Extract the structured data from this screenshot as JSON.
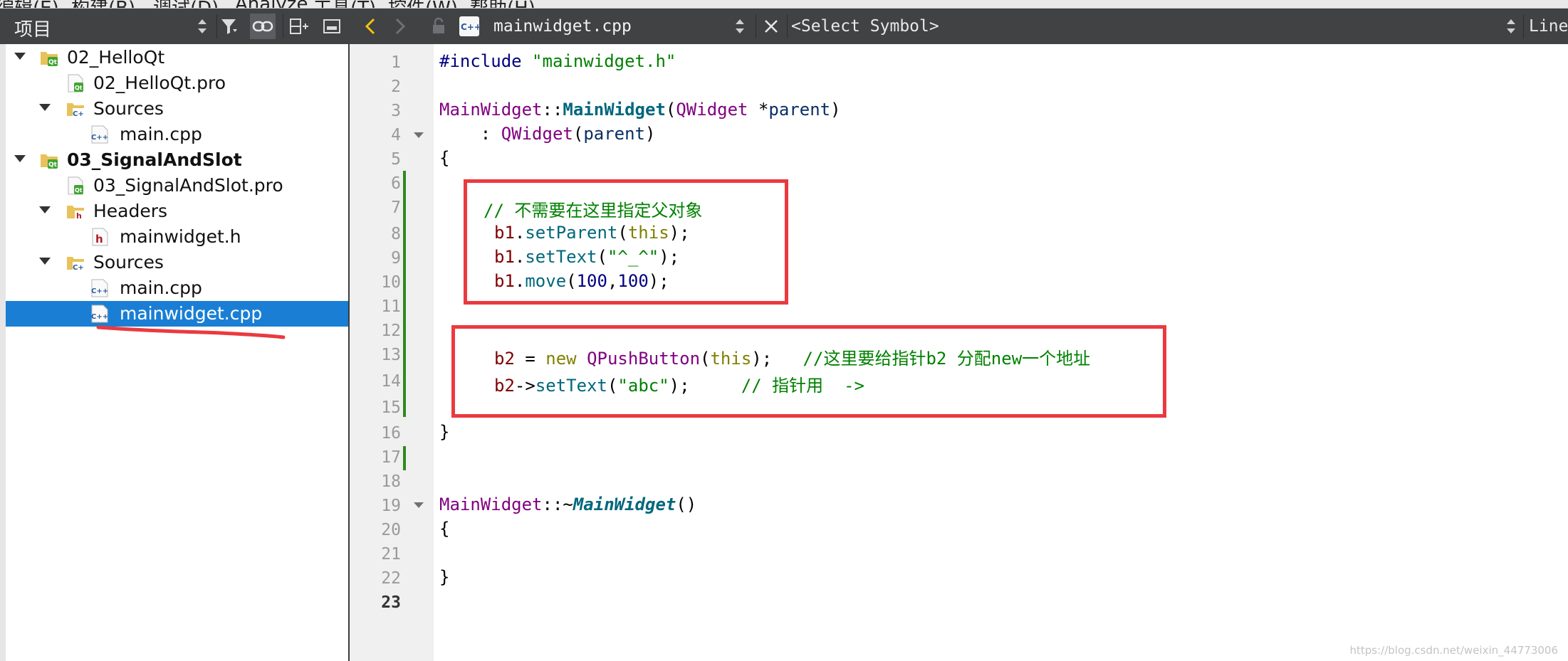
{
  "menubar": {
    "items": [
      "编辑(E)",
      "构建(B)",
      "调试(D)",
      "Analyze",
      "工具(T)",
      "控件(W)",
      "帮助(H)"
    ]
  },
  "project_panel": {
    "title": "项目",
    "tree": [
      {
        "label": "02_HelloQt",
        "icon": "qt-project-folder-icon",
        "bold": false
      },
      {
        "label": "02_HelloQt.pro",
        "icon": "pro-file-icon",
        "bold": false
      },
      {
        "label": "Sources",
        "icon": "cpp-sources-folder-icon",
        "bold": false
      },
      {
        "label": "main.cpp",
        "icon": "cpp-file-icon",
        "bold": false
      },
      {
        "label": "03_SignalAndSlot",
        "icon": "qt-project-folder-icon",
        "bold": true
      },
      {
        "label": "03_SignalAndSlot.pro",
        "icon": "pro-file-icon",
        "bold": false
      },
      {
        "label": "Headers",
        "icon": "header-folder-icon",
        "bold": false
      },
      {
        "label": "mainwidget.h",
        "icon": "header-file-icon",
        "bold": false
      },
      {
        "label": "Sources",
        "icon": "cpp-sources-folder-icon",
        "bold": false
      },
      {
        "label": "main.cpp",
        "icon": "cpp-file-icon",
        "bold": false
      },
      {
        "label": "mainwidget.cpp",
        "icon": "cpp-file-icon",
        "bold": false,
        "selected": true
      }
    ]
  },
  "editor": {
    "file_name": "mainwidget.cpp",
    "symbol_placeholder": "<Select Symbol>",
    "line_label": "Line:",
    "current_line": 23,
    "line_numbers": [
      "1",
      "2",
      "3",
      "4",
      "5",
      "6",
      "7",
      "8",
      "9",
      "10",
      "11",
      "12",
      "13",
      "14",
      "15",
      "16",
      "17",
      "18",
      "19",
      "20",
      "21",
      "22",
      "23"
    ],
    "code": {
      "l1_directive": "#include",
      "l1_header": "\"mainwidget.h\"",
      "l3_class": "MainWidget",
      "l3_sep": "::",
      "l3_ctor": "MainWidget",
      "l3_open": "(",
      "l3_param_type": "QWidget",
      "l3_star": " *",
      "l3_param": "parent",
      "l3_close": ")",
      "l4_colon": "    : ",
      "l4_base": "QWidget",
      "l4_open": "(",
      "l4_arg": "parent",
      "l4_close": ")",
      "l5": "{",
      "l7_comment": "// 不需要在这里指定父对象",
      "l8_obj": "b1",
      "l8_dot": ".",
      "l8_fn": "setParent",
      "l8_open": "(",
      "l8_arg": "this",
      "l8_close": ");",
      "l9_obj": "b1",
      "l9_dot": ".",
      "l9_fn": "setText",
      "l9_open": "(",
      "l9_str": "\"^_^\"",
      "l9_close": ");",
      "l10_obj": "b1",
      "l10_dot": ".",
      "l10_fn": "move",
      "l10_open": "(",
      "l10_n1": "100",
      "l10_comma": ",",
      "l10_n2": "100",
      "l10_close": ");",
      "l13_obj": "b2",
      "l13_eq": " = ",
      "l13_new": "new",
      "l13_sp": " ",
      "l13_cls": "QPushButton",
      "l13_open": "(",
      "l13_this": "this",
      "l13_close": ");",
      "l13_gap": "   ",
      "l13_comment": "//这里要给指针b2 分配new一个地址",
      "l14_obj": "b2",
      "l14_arrow": "->",
      "l14_fn": "setText",
      "l14_open": "(",
      "l14_str": "\"abc\"",
      "l14_close": ");",
      "l14_gap": "     ",
      "l14_comment": "// 指针用  ->",
      "l16": "}",
      "l19_class": "MainWidget",
      "l19_sep": "::~",
      "l19_dtor": "MainWidget",
      "l19_parens": "()",
      "l20": "{",
      "l22": "}"
    }
  },
  "watermark": "https://blog.csdn.net/weixin_44773006",
  "colors": {
    "toolbar_bg": "#404244",
    "selection": "#1a7fd4",
    "annotation_red": "#ea3a3f",
    "change_bar": "#2f8a1f"
  }
}
